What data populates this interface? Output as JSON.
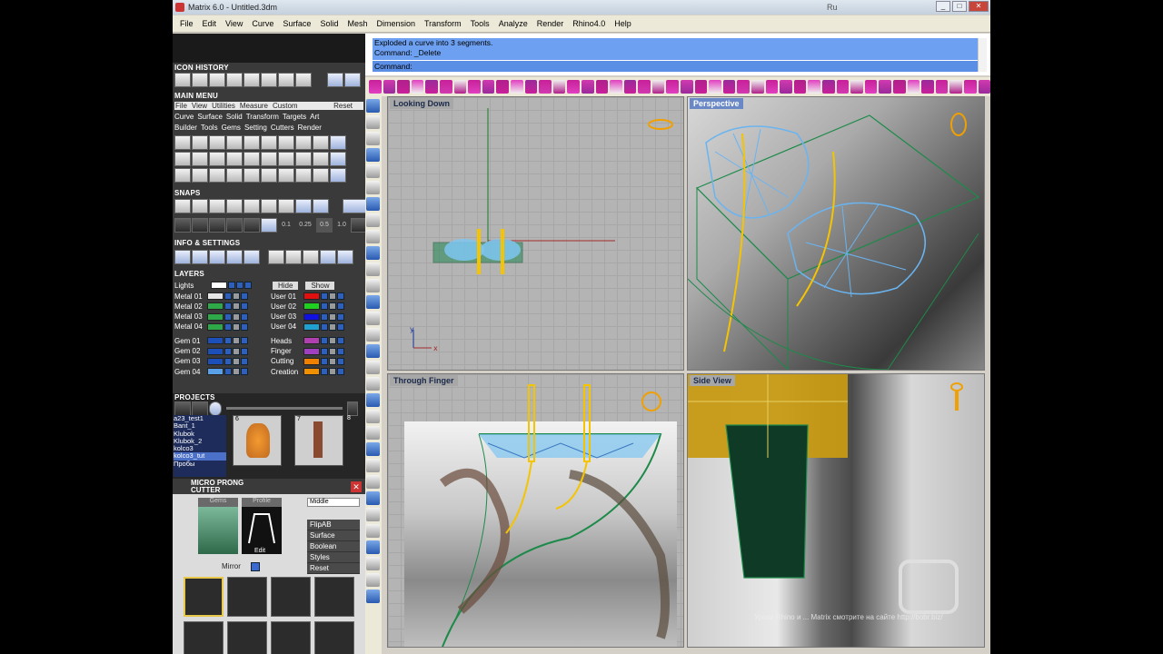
{
  "window": {
    "title": "Matrix 6.0 - Untitled.3dm",
    "language_indicator": "Ru"
  },
  "menu": [
    "File",
    "Edit",
    "View",
    "Curve",
    "Surface",
    "Solid",
    "Mesh",
    "Dimension",
    "Transform",
    "Tools",
    "Analyze",
    "Render",
    "Rhino4.0",
    "Help"
  ],
  "left_panel": {
    "icon_history_title": "ICON HISTORY",
    "main_menu_title": "MAIN MENU",
    "main_menu_tabs": [
      "File",
      "View",
      "Utilities",
      "Measure",
      "Custom",
      "Reset"
    ],
    "main_menu_row1": [
      "Curve",
      "Surface",
      "Solid",
      "Transform",
      "Targets",
      "Art"
    ],
    "main_menu_row2": [
      "Builder",
      "Tools",
      "Gems",
      "Setting",
      "Cutters",
      "Render"
    ],
    "snaps_title": "SNAPS",
    "snap_values": [
      "0.1",
      "0.25",
      "0.5",
      "1.0"
    ],
    "info_title": "INFO & SETTINGS",
    "layers_title": "LAYERS",
    "lights_label": "Lights",
    "hide_label": "Hide",
    "show_label": "Show",
    "layers_left": [
      {
        "name": "Metal 01",
        "color": "#e6e6e6"
      },
      {
        "name": "Metal 02",
        "color": "#2fa84a"
      },
      {
        "name": "Metal 03",
        "color": "#2fa84a"
      },
      {
        "name": "Metal 04",
        "color": "#2fa84a"
      },
      {
        "name": "Gem 01",
        "color": "#1c4fb8"
      },
      {
        "name": "Gem 02",
        "color": "#1c4fb8"
      },
      {
        "name": "Gem 03",
        "color": "#1c4fb8"
      },
      {
        "name": "Gem 04",
        "color": "#5aa0e8"
      }
    ],
    "layers_right": [
      {
        "name": "User 01",
        "color": "#e01010"
      },
      {
        "name": "User 02",
        "color": "#20d020"
      },
      {
        "name": "User 03",
        "color": "#1010e0"
      },
      {
        "name": "User 04",
        "color": "#20a0d0"
      },
      {
        "name": "Heads",
        "color": "#b040b0"
      },
      {
        "name": "Finger",
        "color": "#a040c0"
      },
      {
        "name": "Cutting",
        "color": "#f08000"
      },
      {
        "name": "Creation",
        "color": "#f09000"
      }
    ],
    "projects_title": "PROJECTS",
    "projects": [
      "a23_test1",
      "Bant_1",
      "Klubok",
      "Klubok_2",
      "kolco3",
      "kolco3_tut",
      "Пробы"
    ],
    "project_thumbs": [
      "6",
      "7",
      "8"
    ],
    "micro_title_1": "MICRO PRONG",
    "micro_title_2": "CUTTER",
    "gems_tab": "Gems",
    "profile_tab": "Profile",
    "dropdown_value": "Middle",
    "options": [
      "FlipAB",
      "Surface",
      "Boolean",
      "Styles",
      "Reset"
    ],
    "edit_label": "Edit",
    "mirror_label": "Mirror"
  },
  "command": {
    "history_line1": "Exploded a curve into 3 segments.",
    "history_line2": "Command: _Delete",
    "prompt": "Command:"
  },
  "viewports": [
    {
      "label": "Looking Down",
      "active": false
    },
    {
      "label": "Perspective",
      "active": true
    },
    {
      "label": "Through Finger",
      "active": false
    },
    {
      "label": "Side View",
      "active": false
    }
  ],
  "watermark": "Уроки Rhino и ... Matrix смотрите на сайте http://bobr.biz/",
  "colors": {
    "accent_blue": "#6da0f0",
    "wire_green": "#1e8a4a",
    "wire_blue": "#6ab4f0",
    "prong_yellow": "#f5c400"
  }
}
